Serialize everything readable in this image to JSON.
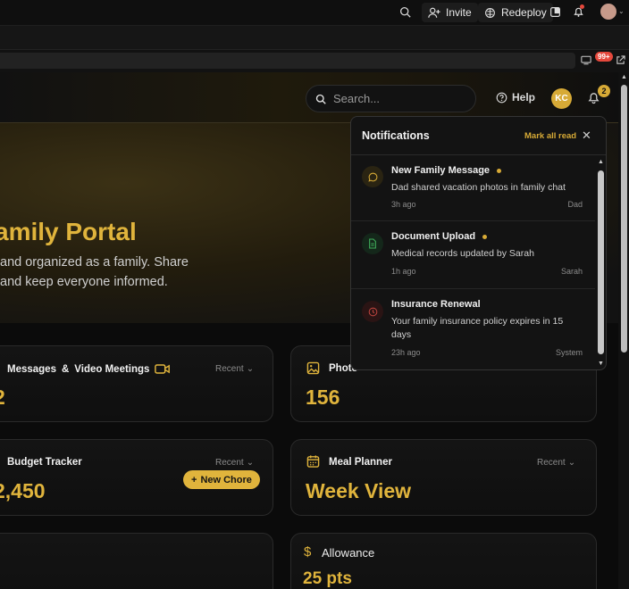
{
  "ide": {
    "invite_label": "Invite",
    "redeploy_label": "Redeploy",
    "devtools_badge": "99+"
  },
  "header": {
    "search_placeholder": "Search...",
    "help_label": "Help",
    "avatar_initials": "KC",
    "notification_count": "2"
  },
  "hero": {
    "title": "amily Portal",
    "subtitle_line1": "and organized as a family. Share",
    "subtitle_line2": "and keep everyone informed."
  },
  "cards": {
    "messages": {
      "title_a": "Messages",
      "amp": "&",
      "title_b": "Video Meetings",
      "recent": "Recent",
      "value": "2"
    },
    "photos": {
      "title": "Photo",
      "value": "156"
    },
    "budget": {
      "title": "Budget Tracker",
      "recent": "Recent",
      "value": "2,450"
    },
    "meal": {
      "title": "Meal Planner",
      "recent": "Recent",
      "value": "Week View"
    },
    "chores": {
      "button": "New Chore"
    },
    "allowance": {
      "title": "Allowance",
      "value": "25 pts"
    }
  },
  "notifications": {
    "title": "Notifications",
    "mark_all": "Mark all read",
    "items": [
      {
        "title": "New Family Message",
        "body": "Dad shared vacation photos in family chat",
        "time": "3h ago",
        "source": "Dad",
        "unread": true,
        "color": "#d7aa36"
      },
      {
        "title": "Document Upload",
        "body": "Medical records updated by Sarah",
        "time": "1h ago",
        "source": "Sarah",
        "unread": true,
        "color": "#3fae5b"
      },
      {
        "title": "Insurance Renewal",
        "body": "Your family insurance policy expires in 15 days",
        "time": "23h ago",
        "source": "System",
        "unread": false,
        "color": "#c0453f"
      }
    ]
  }
}
